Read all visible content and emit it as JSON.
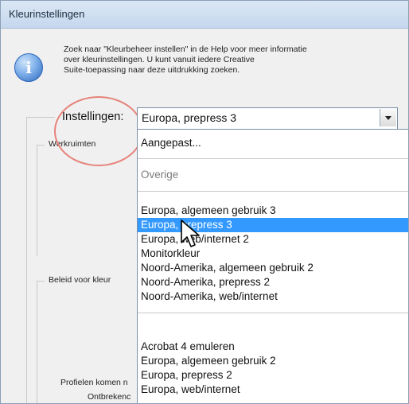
{
  "window": {
    "title": "Kleurinstellingen"
  },
  "info": {
    "icon": "info-icon",
    "text": "Zoek naar \"Kleurbeheer instellen\" in de Help voor meer informatie\nover kleurinstellingen. U kunt vanuit iedere Creative\nSuite-toepassing naar deze uitdrukking zoeken."
  },
  "settings": {
    "label": "Instellingen:",
    "value": "Europa, prepress 3"
  },
  "groups": {
    "werkruimten": "Werkruimten",
    "beleid": "Beleid voor kleur",
    "profielen": "Profielen komen n",
    "ontbrekend": "Ontbrekenc"
  },
  "dropdown": {
    "aangepast": "Aangepast...",
    "overige": "Overige",
    "group1": [
      "Europa, algemeen gebruik 3",
      "Europa, prepress 3",
      "Europa, web/internet 2",
      "Monitorkleur",
      "Noord-Amerika, algemeen gebruik 2",
      "Noord-Amerika, prepress 2",
      "Noord-Amerika, web/internet"
    ],
    "group2": [
      "Acrobat 4 emuleren",
      "Europa, algemeen gebruik 2",
      "Europa, prepress 2",
      "Europa, web/internet"
    ],
    "selected": "Europa, prepress 3"
  },
  "colors": {
    "selection": "#3399ff",
    "highlight_circle": "#e6837a",
    "title_bar": "#c5d7ee"
  }
}
